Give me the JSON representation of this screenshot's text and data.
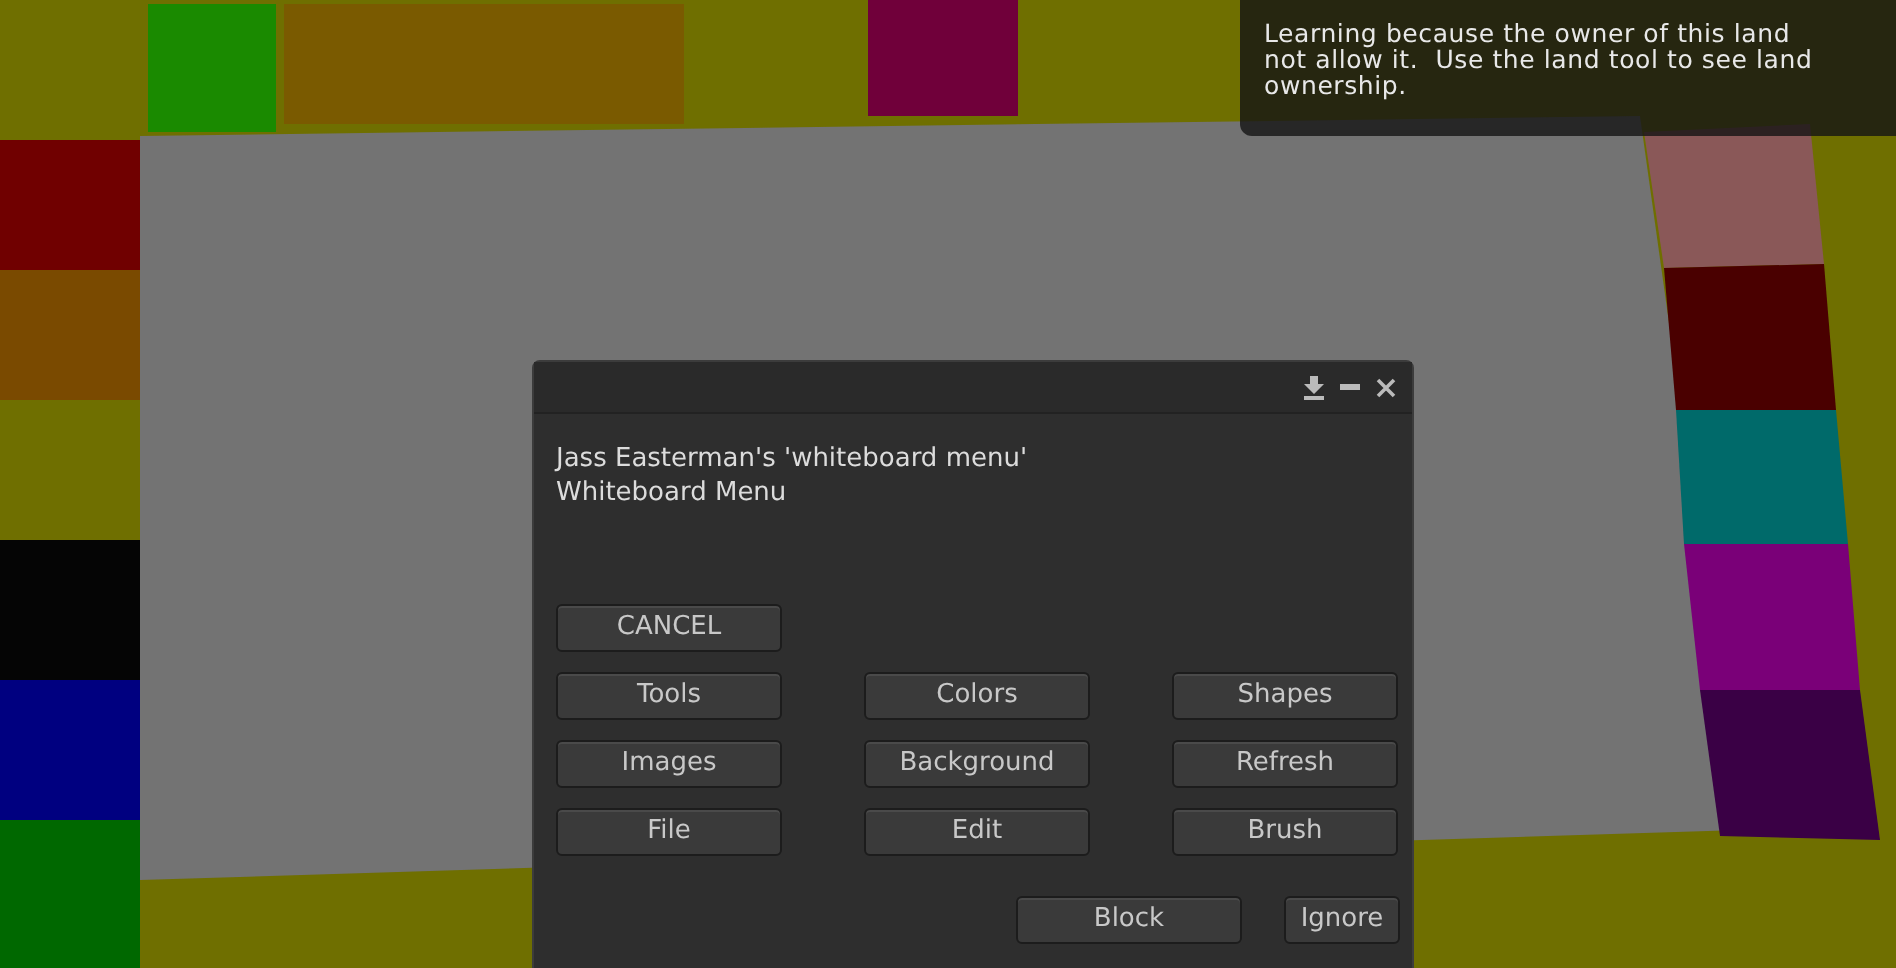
{
  "notification": {
    "lines": [
      "Learning because the owner of this land",
      "not allow it.  Use the land tool to see land",
      "ownership."
    ]
  },
  "dialog": {
    "message": [
      "Jass Easterman's 'whiteboard menu'",
      "Whiteboard Menu"
    ],
    "button_rows": [
      [
        "CANCEL"
      ],
      [
        "Tools",
        "Colors",
        "Shapes"
      ],
      [
        "Images",
        "Background",
        "Refresh"
      ],
      [
        "File",
        "Edit",
        "Brush"
      ]
    ],
    "footer_buttons": [
      "Block",
      "Ignore"
    ]
  }
}
